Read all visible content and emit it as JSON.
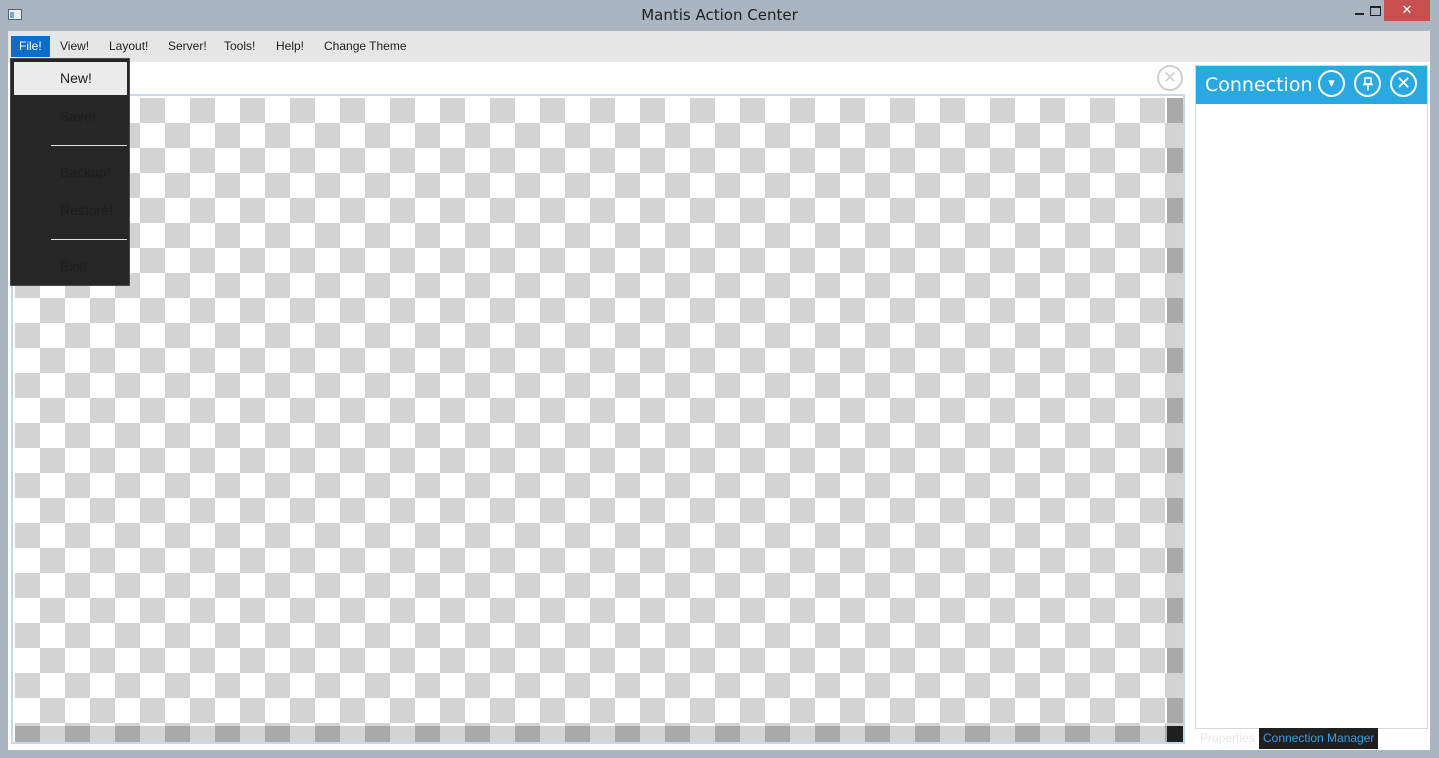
{
  "window": {
    "title": "Mantis Action Center",
    "minimize_glyph": "",
    "close_glyph": "✕"
  },
  "menubar": {
    "items": [
      {
        "label": "File!",
        "active": true
      },
      {
        "label": "View!"
      },
      {
        "label": "Layout!"
      },
      {
        "label": "Server!"
      },
      {
        "label": "Tools!"
      },
      {
        "label": "Help!"
      },
      {
        "label": "Change Theme"
      }
    ]
  },
  "file_menu": {
    "items": [
      "New!",
      "Save!",
      "Backup!",
      "Restore!",
      "Exit!"
    ]
  },
  "document": {
    "close_glyph": "✕"
  },
  "side_panel": {
    "title": "Connection",
    "dropdown_glyph": "▾",
    "pin_glyph": "📌",
    "close_glyph": "✕"
  },
  "bottom_tabs": {
    "items": [
      "Properties",
      "Connection Manager"
    ],
    "selected": "Connection Manager"
  },
  "colors": {
    "accent": "#2aa8e0",
    "menu_active": "#0c6ec8",
    "close_button": "#c7504e"
  }
}
